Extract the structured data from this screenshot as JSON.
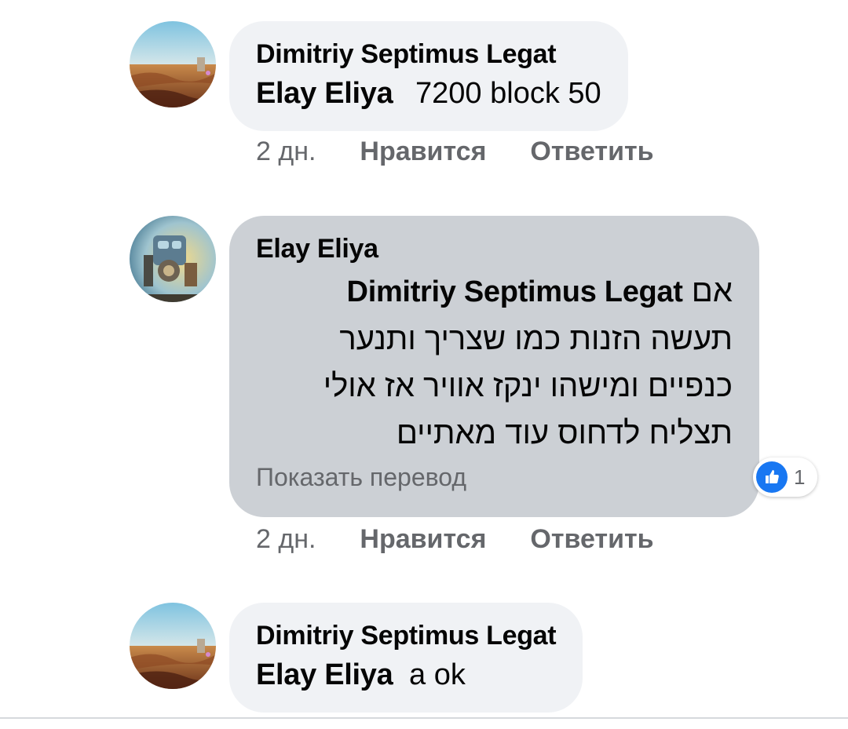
{
  "comments": [
    {
      "author": "Dimitriy Septimus Legat",
      "mention": "Elay Eliya",
      "text": "7200 block 50",
      "time": "2 дн.",
      "like_label": "Нравится",
      "reply_label": "Ответить",
      "avatar_icon": "desert-landscape-avatar"
    },
    {
      "author": "Elay Eliya",
      "mention": "Dimitriy Septimus Legat",
      "rtl_first": "אם",
      "rtl_lines": [
        "תעשה הזנות כמו שצריך ותנער",
        "כנפיים ומישהו ינקז אוויר אז אולי",
        "תצליח לדחוס עוד  מאתיים"
      ],
      "translate_label": "Показать перевод",
      "reaction_count": "1",
      "reaction_icon": "like-thumb-icon",
      "time": "2 дн.",
      "like_label": "Нравится",
      "reply_label": "Ответить",
      "avatar_icon": "robot-avatar"
    },
    {
      "author": "Dimitriy Septimus Legat",
      "mention": "Elay Eliya",
      "text": "a ok",
      "avatar_icon": "desert-landscape-avatar"
    }
  ],
  "colors": {
    "bubble": "#f0f2f5",
    "bubble_highlight": "#ccd0d5",
    "secondary_text": "#65676b",
    "like_blue": "#1877f2"
  }
}
